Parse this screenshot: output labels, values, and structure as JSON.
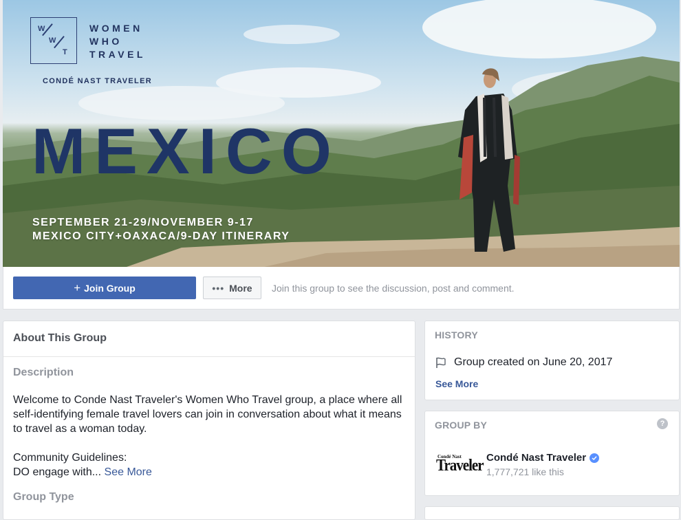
{
  "cover": {
    "logo_letters": [
      "W",
      "W",
      "T"
    ],
    "logo_text": [
      "WOMEN",
      "WHO",
      "TRAVEL"
    ],
    "publisher": "CONDÉ NAST TRAVELER",
    "headline": "MEXICO",
    "dates_line1": "SEPTEMBER 21-29/NOVEMBER 9-17",
    "dates_line2": "MEXICO CITY+OAXACA/9-DAY ITINERARY"
  },
  "actions": {
    "join_label": "Join Group",
    "more_label": "More",
    "join_message": "Join this group to see the discussion, post and comment."
  },
  "about": {
    "title": "About This Group",
    "description_heading": "Description",
    "description": "Welcome to Conde Nast Traveler's Women Who Travel group, a place where all self-identifying female travel lovers can join in conversation about what it means to travel as a woman today.",
    "guidelines_line1": "Community Guidelines:",
    "guidelines_line2": "DO engage with...",
    "see_more": "See More",
    "group_type_heading": "Group Type"
  },
  "history": {
    "heading": "HISTORY",
    "created": "Group created on June 20, 2017",
    "see_more": "See More"
  },
  "group_by": {
    "heading": "GROUP BY",
    "help": "?",
    "logo_small": "Condé Nast",
    "logo_big": "Traveler",
    "page_name": "Condé Nast Traveler",
    "likes": "1,777,721 like this"
  },
  "colors": {
    "brand_blue": "#4267b2",
    "link_blue": "#385898",
    "navy_text": "#1f3566",
    "verified_blue": "#5890ff"
  }
}
